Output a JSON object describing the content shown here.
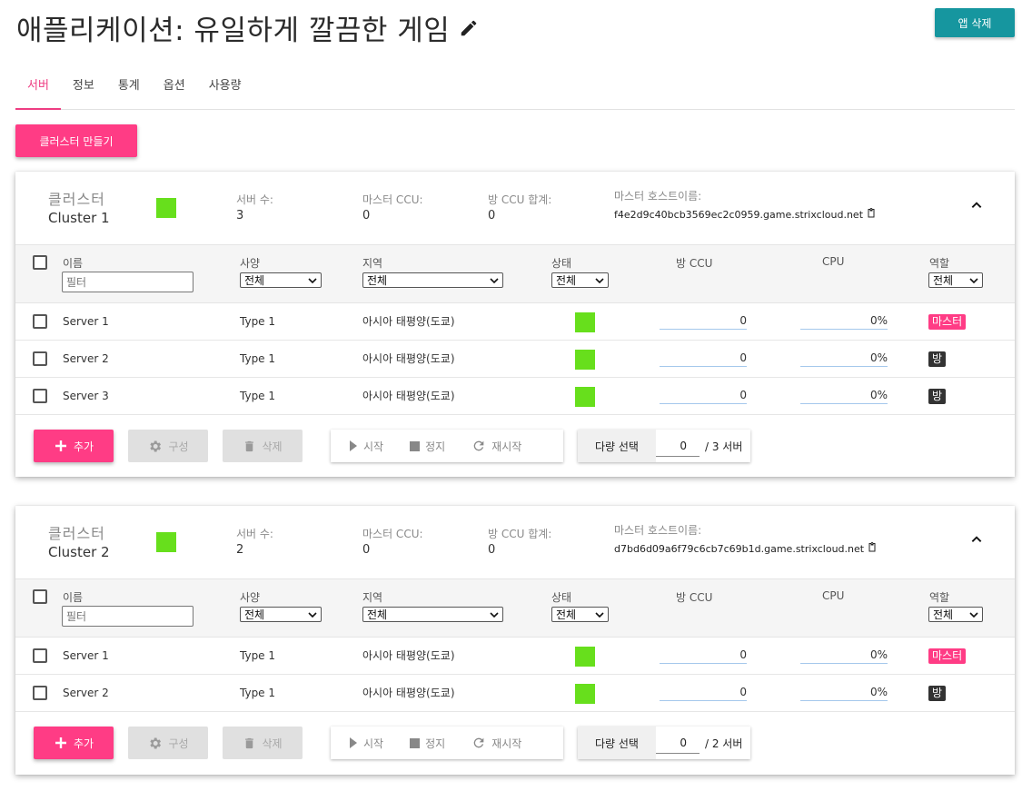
{
  "app": {
    "title": "애플리케이션: 유일하게 깔끔한 게임",
    "delete_label": "앱 삭제"
  },
  "tabs": [
    {
      "label": "서버",
      "active": true
    },
    {
      "label": "정보",
      "active": false
    },
    {
      "label": "통계",
      "active": false
    },
    {
      "label": "옵션",
      "active": false
    },
    {
      "label": "사용량",
      "active": false
    }
  ],
  "create_cluster_label": "클러스터 만들기",
  "labels": {
    "cluster": "클러스터",
    "server_count": "서버 수:",
    "master_ccu": "마스터 CCU:",
    "room_ccu_total": "방 CCU 합계:",
    "master_host": "마스터 호스트이름:",
    "col_name": "이름",
    "col_spec": "사양",
    "col_region": "지역",
    "col_status": "상태",
    "col_room_ccu": "방 CCU",
    "col_cpu": "CPU",
    "col_role": "역할",
    "filter_placeholder": "필터",
    "all": "전체",
    "add": "추가",
    "configure": "구성",
    "delete": "삭제",
    "start": "시작",
    "stop": "정지",
    "restart": "재시작",
    "multi_select": "다량 선택",
    "role_master": "마스터",
    "role_room": "방"
  },
  "colors": {
    "accent": "#ff3c85",
    "teal": "#16969f",
    "status_ok": "#67df1c"
  },
  "clusters": [
    {
      "name": "Cluster 1",
      "server_count": "3",
      "master_ccu": "0",
      "room_ccu_total": "0",
      "host": "f4e2d9c40bcb3569ec2c0959.game.strixcloud.net",
      "selected": "0",
      "total": "/ 3 서버",
      "servers": [
        {
          "name": "Server 1",
          "type": "Type 1",
          "region": "아시아 태평양(도쿄)",
          "room_ccu": "0",
          "cpu": "0%",
          "role": "master"
        },
        {
          "name": "Server 2",
          "type": "Type 1",
          "region": "아시아 태평양(도쿄)",
          "room_ccu": "0",
          "cpu": "0%",
          "role": "room"
        },
        {
          "name": "Server 3",
          "type": "Type 1",
          "region": "아시아 태평양(도쿄)",
          "room_ccu": "0",
          "cpu": "0%",
          "role": "room"
        }
      ]
    },
    {
      "name": "Cluster 2",
      "server_count": "2",
      "master_ccu": "0",
      "room_ccu_total": "0",
      "host": "d7bd6d09a6f79c6cb7c69b1d.game.strixcloud.net",
      "selected": "0",
      "total": "/ 2 서버",
      "servers": [
        {
          "name": "Server 1",
          "type": "Type 1",
          "region": "아시아 태평양(도쿄)",
          "room_ccu": "0",
          "cpu": "0%",
          "role": "master"
        },
        {
          "name": "Server 2",
          "type": "Type 1",
          "region": "아시아 태평양(도쿄)",
          "room_ccu": "0",
          "cpu": "0%",
          "role": "room"
        }
      ]
    }
  ]
}
